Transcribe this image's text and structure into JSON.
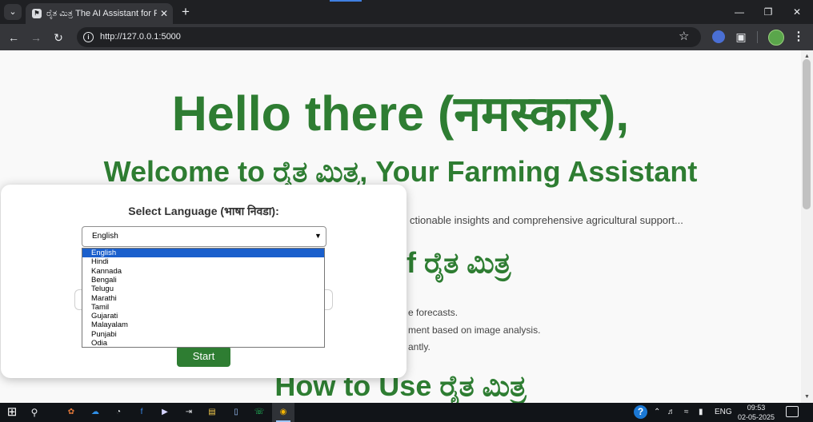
{
  "browser": {
    "tab_title": "ರೈತ ಮಿತ್ರ The AI Assistant for Farmers",
    "url": "http://127.0.0.1:5000",
    "icons": {
      "tab_list": "chevron-down-icon",
      "favicon": "page-favicon-icon",
      "close": "close-icon",
      "new_tab": "plus-icon",
      "back": "arrow-left-icon",
      "forward": "arrow-right-icon",
      "reload": "reload-icon",
      "site_info": "info-icon",
      "bookmark": "star-icon",
      "extensions": "puzzle-icon",
      "profile": "avatar-icon",
      "menu": "kebab-menu-icon"
    }
  },
  "page": {
    "hero_title": "Hello there (नमस्कार),",
    "welcome_title": "Welcome to ರೈತ ಮಿತ್ರ, Your Farming Assistant",
    "intro_text": "ctionable insights and comprehensive agricultural support...",
    "features_heading": "f ರೈತ ಮಿತ್ರ",
    "feature_lines": [
      "e forecasts.",
      "ment based on image analysis.",
      "antly."
    ],
    "howto_heading": "How to Use ರೈತ ಮಿತ್ರ",
    "accent_color": "#2e7d32"
  },
  "modal": {
    "label": "Select Language (भाषा निवडा):",
    "selected_value": "English",
    "options": [
      "English",
      "Hindi",
      "Kannada",
      "Bengali",
      "Telugu",
      "Marathi",
      "Tamil",
      "Gujarati",
      "Malayalam",
      "Punjabi",
      "Odia"
    ],
    "start_label": "Start"
  },
  "taskbar": {
    "language": "ENG",
    "time": "09:53",
    "date": "02-05-2025"
  }
}
